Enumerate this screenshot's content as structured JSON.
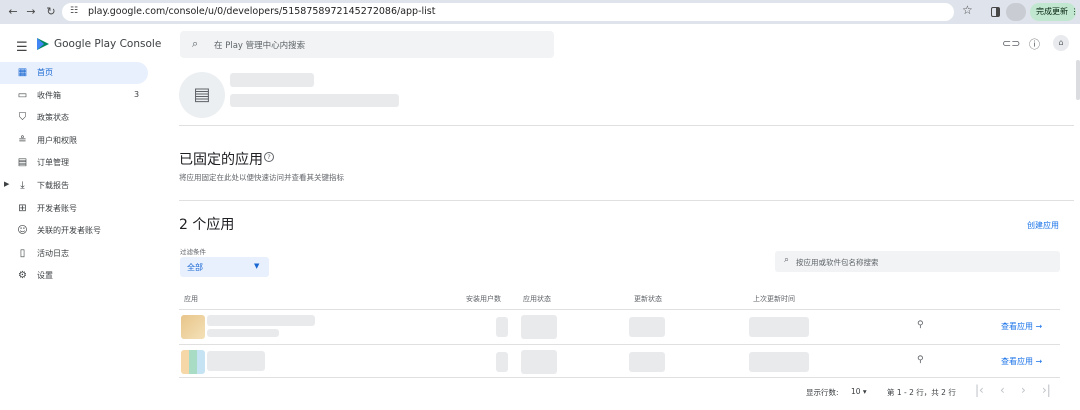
{
  "browser": {
    "url": "play.google.com/console/u/0/developers/5158758972145272086/app-list",
    "update_label": "完成更新"
  },
  "app": {
    "logo_text": "Google Play Console",
    "search_placeholder": "在 Play 管理中心内搜索"
  },
  "sidebar": {
    "items": [
      {
        "label": "首页",
        "icon": "grid-icon"
      },
      {
        "label": "收件箱",
        "icon": "inbox-icon",
        "badge": "3"
      },
      {
        "label": "政策状态",
        "icon": "shield-icon"
      },
      {
        "label": "用户和权限",
        "icon": "people-icon"
      },
      {
        "label": "订单管理",
        "icon": "card-icon"
      },
      {
        "label": "下载报告",
        "icon": "download-icon"
      },
      {
        "label": "开发者账号",
        "icon": "badge-icon"
      },
      {
        "label": "关联的开发者账号",
        "icon": "linked-account-icon"
      },
      {
        "label": "活动日志",
        "icon": "document-icon"
      },
      {
        "label": "设置",
        "icon": "gear-icon"
      }
    ]
  },
  "pinned": {
    "title": "已固定的应用",
    "subtitle": "将应用固定在此处以便快速访问并查看其关键指标"
  },
  "apps": {
    "title": "2 个应用",
    "create_label": "创建应用",
    "filter_label": "过滤条件",
    "filter_value": "全部",
    "search_placeholder": "按应用或软件包名称搜索",
    "columns": [
      "应用",
      "安装用户数",
      "应用状态",
      "更新状态",
      "上次更新时间"
    ],
    "rows": [
      {
        "view_label": "查看应用 →"
      },
      {
        "view_label": "查看应用 →"
      }
    ]
  },
  "pagination": {
    "rows_label": "显示行数:",
    "rows_value": "10",
    "range_label": "第 1 - 2 行，共 2 行"
  }
}
